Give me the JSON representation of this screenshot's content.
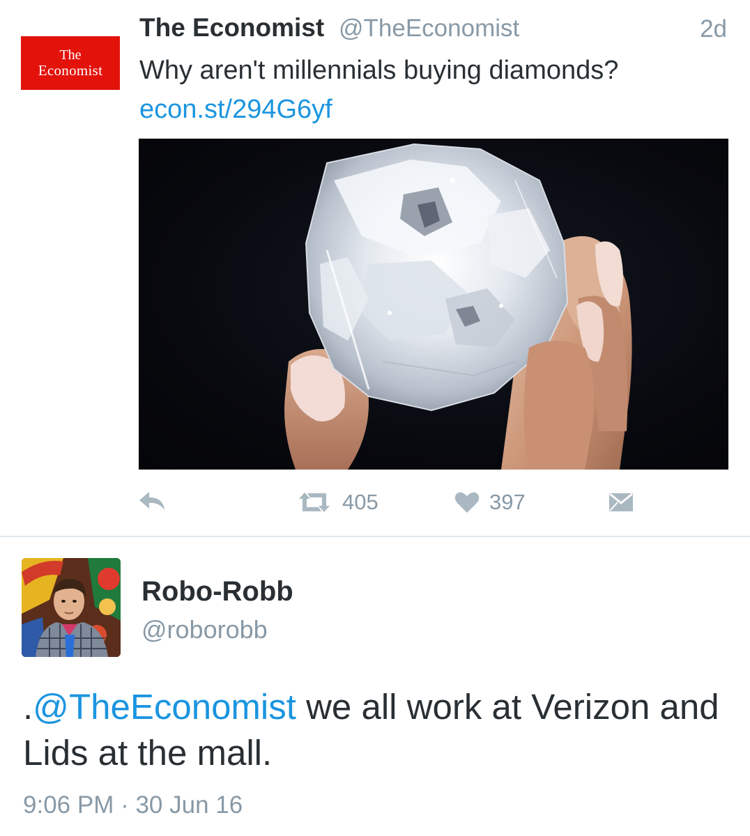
{
  "tweet": {
    "avatar_lines": [
      "The",
      "Economist"
    ],
    "display_name": "The Economist",
    "handle": "@TheEconomist",
    "time": "2d",
    "text": "Why aren't millennials buying diamonds?",
    "link": "econ.st/294G6yf",
    "actions": {
      "retweet_count": "405",
      "like_count": "397"
    }
  },
  "reply_tweet": {
    "display_name": "Robo-Robb",
    "handle": "@roborobb",
    "text_prefix": ".",
    "mention": "@TheEconomist",
    "text_rest": " we all work at Verizon and Lids at the mall.",
    "timestamp": "9:06 PM · 30 Jun 16"
  },
  "colors": {
    "link_blue": "#1b95e0",
    "muted_gray": "#8899a6",
    "icon_gray": "#aab8c2",
    "economist_red": "#e3120b"
  }
}
